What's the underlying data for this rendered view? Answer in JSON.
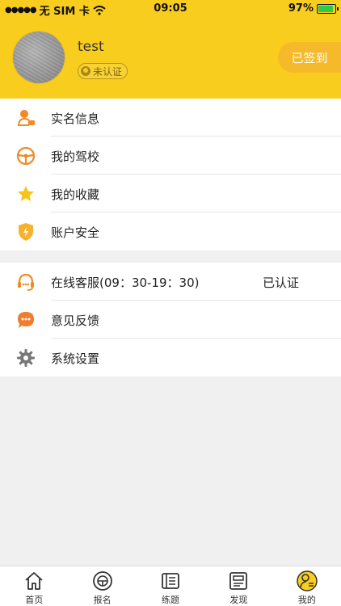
{
  "status_bar": {
    "carrier": "无 SIM 卡",
    "time": "09:05",
    "battery": "97%"
  },
  "profile": {
    "username": "test",
    "verify_status": "未认证",
    "signin_label": "已签到"
  },
  "menu_group1": [
    {
      "label": "实名信息",
      "icon": "id-card-icon"
    },
    {
      "label": "我的驾校",
      "icon": "steering-wheel-icon"
    },
    {
      "label": "我的收藏",
      "icon": "star-icon"
    },
    {
      "label": "账户安全",
      "icon": "shield-icon"
    }
  ],
  "menu_group2": [
    {
      "label": "在线客服(09：30-19：30)",
      "extra": "已认证",
      "icon": "headset-icon"
    },
    {
      "label": "意见反馈",
      "icon": "chat-bubble-icon"
    },
    {
      "label": "系统设置",
      "icon": "gear-icon"
    }
  ],
  "tabs": [
    {
      "label": "首页",
      "icon": "home-icon"
    },
    {
      "label": "报名",
      "icon": "register-icon"
    },
    {
      "label": "练题",
      "icon": "practice-icon"
    },
    {
      "label": "发现",
      "icon": "discover-icon"
    },
    {
      "label": "我的",
      "icon": "profile-icon"
    }
  ],
  "colors": {
    "brand": "#f8cd1e",
    "accent": "#f08a24",
    "background": "#f0f0f0"
  }
}
